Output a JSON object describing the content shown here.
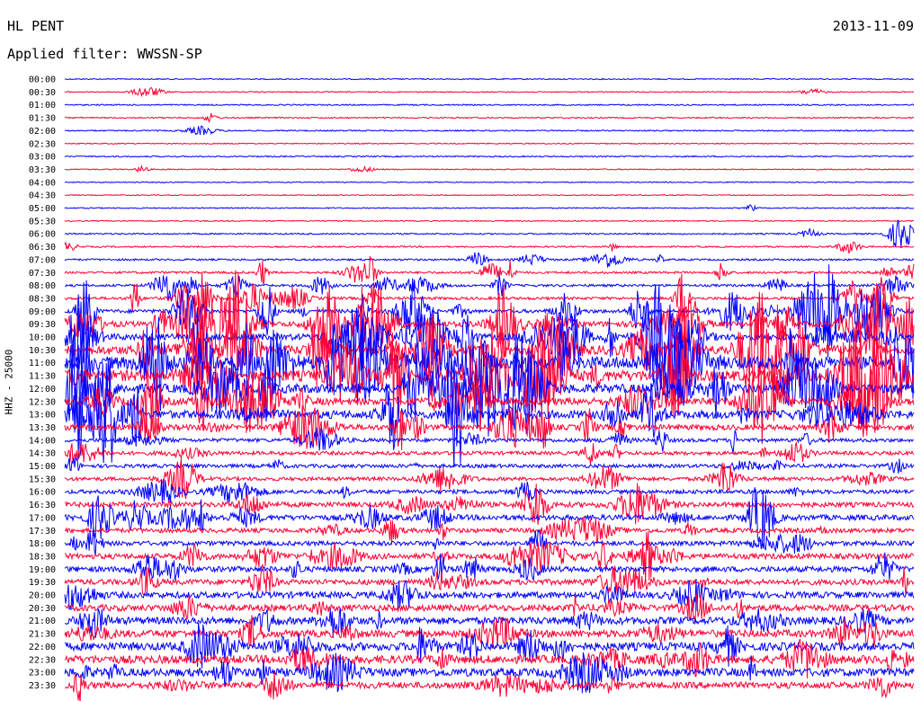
{
  "header": {
    "station": "HL PENT",
    "date": "2013-11-09",
    "filter": "Applied filter: WWSSN-SP",
    "channel_label": "HHZ - 25000"
  },
  "colors": {
    "trace_a": "#0000ff",
    "trace_b": "#ff0033",
    "text": "#000000",
    "background": "#ffffff"
  },
  "chart_data": {
    "type": "line",
    "title": "HL PENT",
    "subtitle": "Applied filter: WWSSN-SP",
    "ylabel": "HHZ - 25000",
    "xlabel": "",
    "grid": false,
    "row_labels": [
      "00:00",
      "00:30",
      "01:00",
      "01:30",
      "02:00",
      "02:30",
      "03:00",
      "03:30",
      "04:00",
      "04:30",
      "05:00",
      "05:30",
      "06:00",
      "06:30",
      "07:00",
      "07:30",
      "08:00",
      "08:30",
      "09:00",
      "09:30",
      "10:00",
      "10:30",
      "11:00",
      "11:30",
      "12:00",
      "12:30",
      "13:00",
      "13:30",
      "14:00",
      "14:30",
      "15:00",
      "15:30",
      "16:00",
      "16:30",
      "17:00",
      "17:30",
      "18:00",
      "18:30",
      "19:00",
      "19:30",
      "20:00",
      "20:30",
      "21:00",
      "21:30",
      "22:00",
      "22:30",
      "23:00",
      "23:30"
    ],
    "row_colors": [
      "blue",
      "red"
    ],
    "noise_level": [
      0.6,
      0.6,
      0.7,
      0.7,
      0.7,
      0.6,
      0.7,
      0.6,
      0.5,
      0.5,
      0.6,
      0.6,
      0.8,
      0.8,
      1.0,
      1.2,
      1.3,
      1.5,
      2.0,
      3.0,
      3.5,
      5.0,
      7.0,
      6.0,
      5.0,
      4.0,
      4.5,
      3.0,
      2.0,
      2.0,
      2.0,
      2.0,
      2.2,
      2.8,
      3.0,
      2.5,
      2.5,
      3.0,
      3.0,
      3.0,
      3.5,
      3.5,
      4.0,
      4.0,
      4.5,
      4.5,
      4.5,
      3.5
    ],
    "burst_activity": [
      0.02,
      0.05,
      0.02,
      0.03,
      0.05,
      0.02,
      0.02,
      0.03,
      0.01,
      0.01,
      0.03,
      0.02,
      0.05,
      0.1,
      0.12,
      0.35,
      0.4,
      0.6,
      0.8,
      0.9,
      0.9,
      1.0,
      1.0,
      0.9,
      0.95,
      0.8,
      0.85,
      0.6,
      0.3,
      0.25,
      0.25,
      0.3,
      0.25,
      0.35,
      0.5,
      0.3,
      0.3,
      0.5,
      0.4,
      0.35,
      0.3,
      0.25,
      0.3,
      0.3,
      0.4,
      0.4,
      0.35,
      0.3
    ],
    "events": [
      {
        "row": 1,
        "t": 0.88,
        "amplitude": 3
      },
      {
        "row": 7,
        "t": 0.35,
        "amplitude": 3
      },
      {
        "row": 12,
        "t": 0.985,
        "amplitude": 18
      },
      {
        "row": 13,
        "t": 0.0,
        "amplitude": 5
      },
      {
        "row": 14,
        "t": 0.55,
        "amplitude": 6
      }
    ]
  }
}
